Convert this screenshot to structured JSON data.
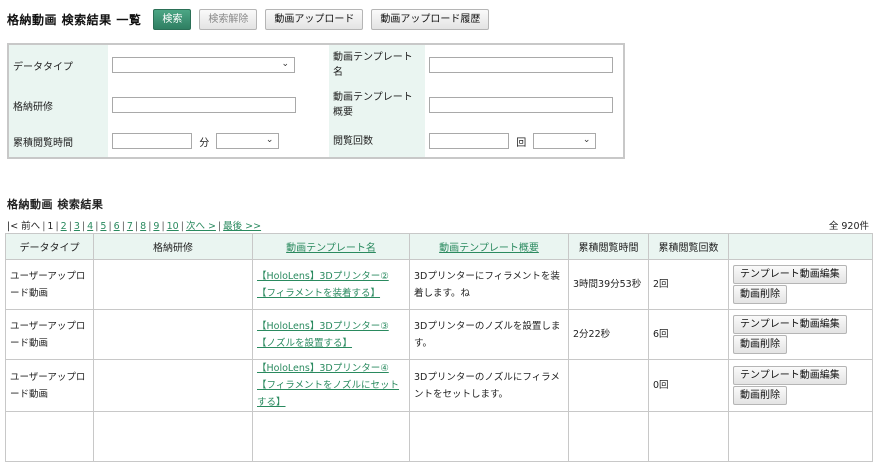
{
  "header": {
    "title": "格納動画 検索結果 一覧",
    "search_label": "検索",
    "clear_label": "検索解除",
    "upload_label": "動画アップロード",
    "history_label": "動画アップロード履歴"
  },
  "search_form": {
    "data_type_label": "データタイプ",
    "data_type_value": "",
    "template_name_label": "動画テンプレート名",
    "template_name_value": "",
    "training_label": "格納研修",
    "training_value": "",
    "template_summary_label": "動画テンプレート概要",
    "template_summary_value": "",
    "view_time_label": "累積閲覧時間",
    "view_time_value": "",
    "view_time_unit": "分",
    "view_count_label": "閲覧回数",
    "view_count_value": "",
    "view_count_unit": "回"
  },
  "results": {
    "title": "格納動画 検索結果",
    "total": "全 920件",
    "pager": {
      "first": "|< 前へ",
      "current": "1",
      "pages": [
        "2",
        "3",
        "4",
        "5",
        "6",
        "7",
        "8",
        "9",
        "10"
      ],
      "next": "次へ >",
      "last": "最後 >>"
    },
    "columns": [
      "データタイプ",
      "格納研修",
      "動画テンプレート名",
      "動画テンプレート概要",
      "累積閲覧時間",
      "累積閲覧回数"
    ],
    "rows": [
      {
        "type": "ユーザーアップロード動画",
        "training": "",
        "name": "【HoloLens】3Dプリンター②【フィラメントを装着する】",
        "summary": "3Dプリンターにフィラメントを装着します。ね",
        "time": "3時間39分53秒",
        "count": "2回"
      },
      {
        "type": "ユーザーアップロード動画",
        "training": "",
        "name": "【HoloLens】3Dプリンター③【ノズルを設置する】",
        "summary": "3Dプリンターのノズルを設置します。",
        "time": "2分22秒",
        "count": "6回"
      },
      {
        "type": "ユーザーアップロード動画",
        "training": "",
        "name": "【HoloLens】3Dプリンター④【フィラメントをノズルにセットする】",
        "summary": "3Dプリンターのノズルにフィラメントをセットします。",
        "time": "",
        "count": "0回"
      }
    ],
    "edit_label": "テンプレート動画編集",
    "delete_label": "動画削除"
  }
}
